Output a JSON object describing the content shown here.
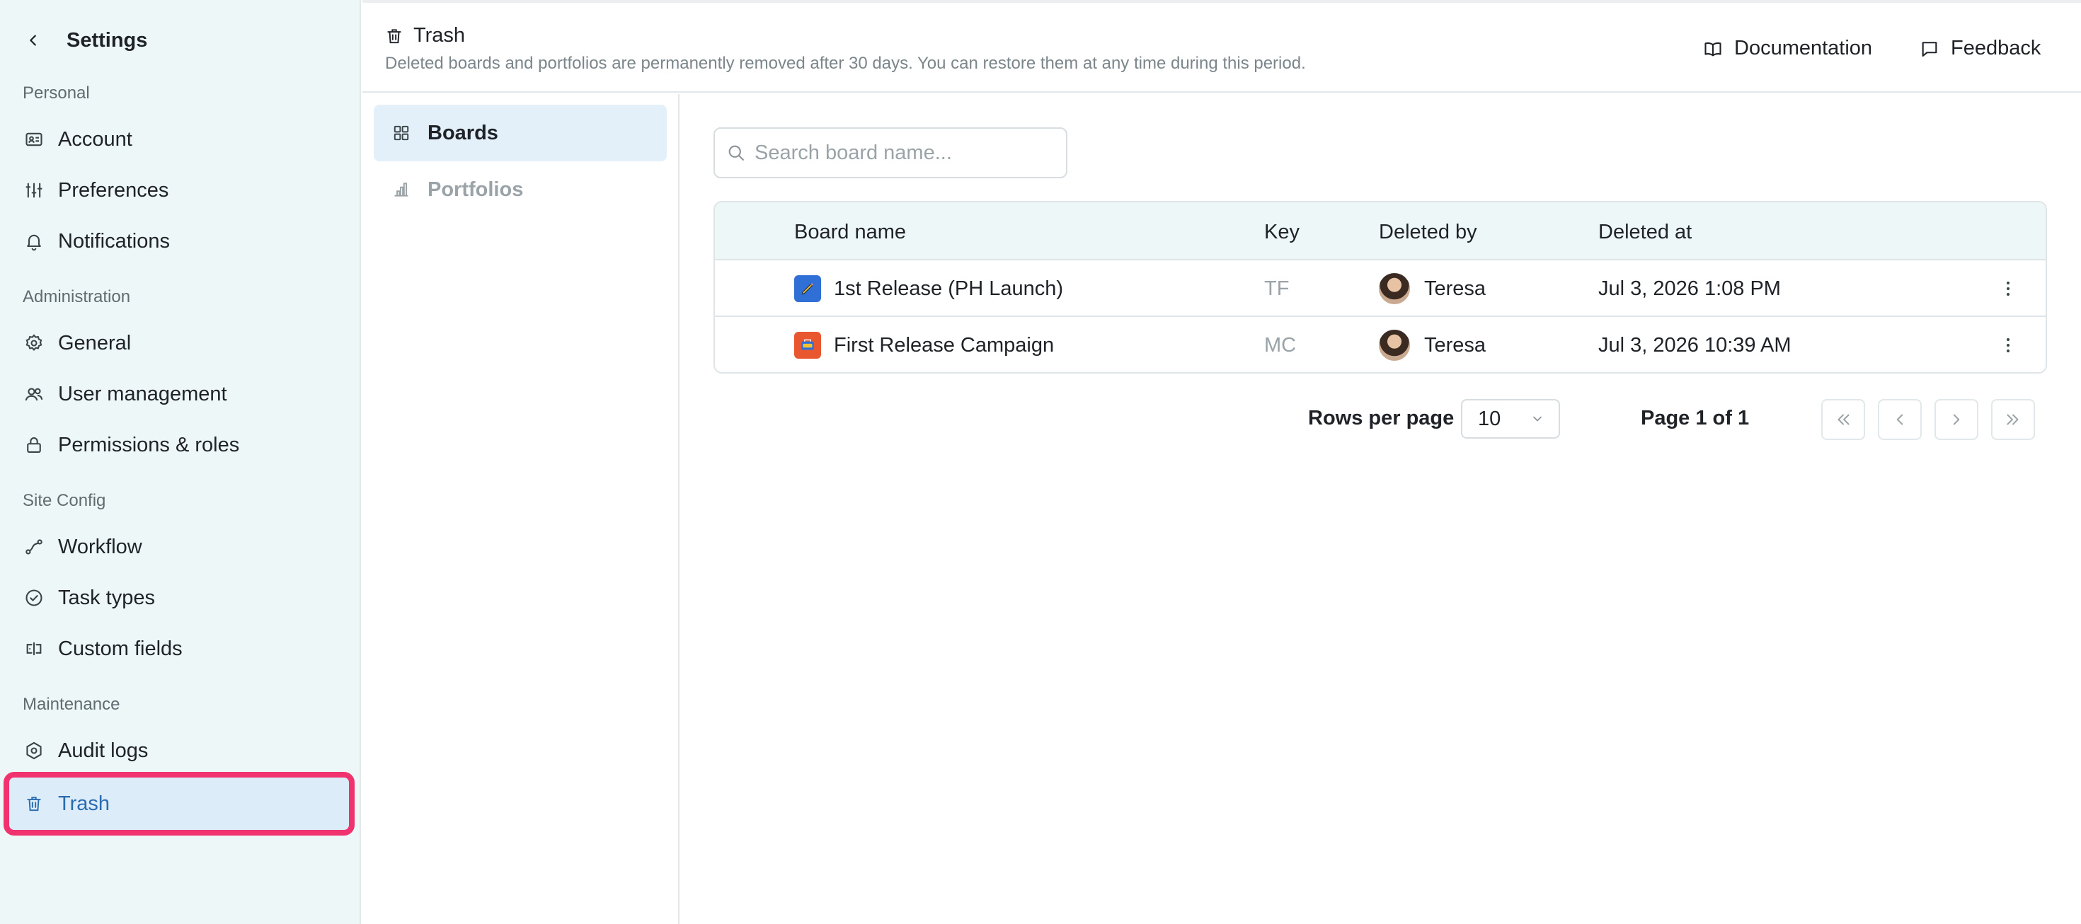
{
  "sidebar": {
    "title": "Settings",
    "sections": [
      {
        "label": "Personal",
        "items": [
          {
            "label": "Account",
            "icon": "id-card-icon"
          },
          {
            "label": "Preferences",
            "icon": "sliders-icon"
          },
          {
            "label": "Notifications",
            "icon": "bell-icon"
          }
        ]
      },
      {
        "label": "Administration",
        "items": [
          {
            "label": "General",
            "icon": "gear-icon"
          },
          {
            "label": "User management",
            "icon": "users-icon"
          },
          {
            "label": "Permissions & roles",
            "icon": "lock-icon"
          }
        ]
      },
      {
        "label": "Site Config",
        "items": [
          {
            "label": "Workflow",
            "icon": "workflow-icon"
          },
          {
            "label": "Task types",
            "icon": "check-circle-icon"
          },
          {
            "label": "Custom fields",
            "icon": "custom-field-icon"
          }
        ]
      },
      {
        "label": "Maintenance",
        "items": [
          {
            "label": "Audit logs",
            "icon": "hexagon-icon"
          },
          {
            "label": "Trash",
            "icon": "trash-icon",
            "active": true
          }
        ]
      }
    ]
  },
  "header": {
    "title": "Trash",
    "subtitle": "Deleted boards and portfolios are permanently removed after 30 days. You can restore them at any time during this period.",
    "documentation_label": "Documentation",
    "feedback_label": "Feedback"
  },
  "subnav": {
    "items": [
      {
        "label": "Boards",
        "active": true
      },
      {
        "label": "Portfolios",
        "active": false
      }
    ]
  },
  "search": {
    "placeholder": "Search board name...",
    "value": ""
  },
  "table": {
    "columns": [
      "Board name",
      "Key",
      "Deleted by",
      "Deleted at"
    ],
    "rows": [
      {
        "name": "1st Release (PH Launch)",
        "key": "TF",
        "deleted_by": "Teresa",
        "deleted_at": "Jul 3, 2026 1:08 PM",
        "icon_color": "#2f6fd6"
      },
      {
        "name": "First Release Campaign",
        "key": "MC",
        "deleted_by": "Teresa",
        "deleted_at": "Jul 3, 2026 10:39 AM",
        "icon_color": "#e8572f"
      }
    ]
  },
  "pagination": {
    "rows_per_page_label": "Rows per page",
    "rows_per_page_value": "10",
    "page_label": "Page 1 of 1"
  },
  "colors": {
    "sidebar_bg": "#eef7f7",
    "active_highlight": "#f0326f",
    "active_item_bg": "#dcedf9",
    "active_text": "#2a6cb0"
  }
}
